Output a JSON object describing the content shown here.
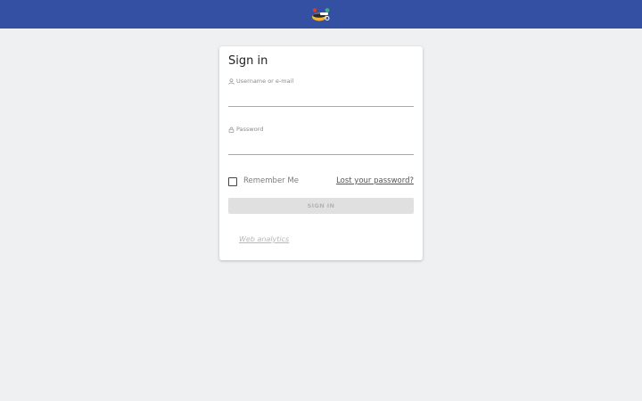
{
  "header": {
    "logo_icon": "matomo-logo-icon",
    "background": "#3450a3"
  },
  "login": {
    "title": "Sign in",
    "username_label": "Username or e-mail",
    "username_value": "",
    "password_label": "Password",
    "password_value": "",
    "remember_label": "Remember Me",
    "remember_checked": false,
    "lost_password_link": "Lost your password?",
    "submit_label": "SIGN IN",
    "footer_link": "Web analytics"
  },
  "colors": {
    "page_bg": "#eef0f2",
    "card_bg": "#ffffff",
    "button_disabled_bg": "#e0e0e0"
  }
}
